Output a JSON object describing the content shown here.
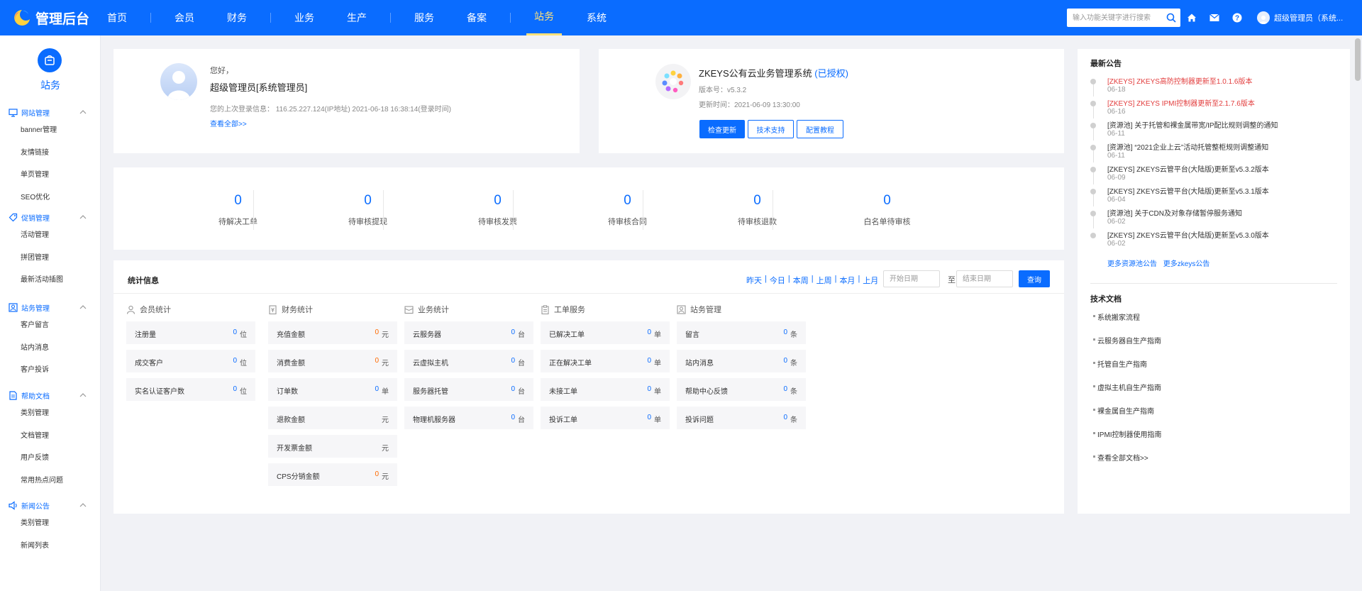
{
  "header": {
    "logo_text": "管理后台",
    "nav": [
      "首页",
      "会员",
      "财务",
      "业务",
      "生产",
      "服务",
      "备案",
      "站务",
      "系统"
    ],
    "active_nav": "站务",
    "search_placeholder": "输入功能关键字进行搜索",
    "user_name": "超级管理员（系统..."
  },
  "sidebar": {
    "title": "站务",
    "groups": [
      {
        "title": "网站管理",
        "icon": "monitor-icon",
        "items": [
          "banner管理",
          "友情链接",
          "单页管理",
          "SEO优化"
        ]
      },
      {
        "title": "促销管理",
        "icon": "tag-icon",
        "items": [
          "活动管理",
          "拼团管理",
          "最新活动插图"
        ]
      },
      {
        "title": "站务管理",
        "icon": "users-icon",
        "items": [
          "客户留言",
          "站内消息",
          "客户投诉"
        ]
      },
      {
        "title": "帮助文档",
        "icon": "document-icon",
        "items": [
          "类别管理",
          "文档管理",
          "用户反馈",
          "常用热点问题"
        ]
      },
      {
        "title": "新闻公告",
        "icon": "speaker-icon",
        "items": [
          "类别管理",
          "新闻列表"
        ]
      }
    ]
  },
  "welcome": {
    "greeting": "您好，",
    "admin_name": "超级管理员[系统管理员]",
    "last_login": "您的上次登录信息：  116.25.227.124(IP地址) 2021-06-18 16:38:14(登录时间)",
    "view_all": "查看全部>>"
  },
  "system": {
    "name": "ZKEYS公有云业务管理系统",
    "auth": "(已授权)",
    "version": "版本号：v5.3.2",
    "updated": "更新时间：2021-06-09 13:30:00",
    "btn_check": "检查更新",
    "btn_support": "技术支持",
    "btn_tutorial": "配置教程"
  },
  "stats": [
    {
      "value": "0",
      "label": "待解决工单"
    },
    {
      "value": "0",
      "label": "待审核提现"
    },
    {
      "value": "0",
      "label": "待审核发票"
    },
    {
      "value": "0",
      "label": "待审核合同"
    },
    {
      "value": "0",
      "label": "待审核退款"
    },
    {
      "value": "0",
      "label": "白名单待审核"
    }
  ],
  "statistics": {
    "title": "统计信息",
    "quick": [
      "昨天",
      "今日",
      "本周",
      "上周",
      "本月",
      "上月"
    ],
    "start_placeholder": "开始日期",
    "to": "至",
    "end_placeholder": "结束日期",
    "query": "查询",
    "columns": [
      {
        "title": "会员统计",
        "icon": "person-icon",
        "rows": [
          {
            "label": "注册量",
            "value": "0",
            "unit": "位"
          },
          {
            "label": "成交客户",
            "value": "0",
            "unit": "位"
          },
          {
            "label": "实名认证客户数",
            "value": "0",
            "unit": "位"
          }
        ]
      },
      {
        "title": "财务统计",
        "icon": "finance-icon",
        "rows": [
          {
            "label": "充值金额",
            "value": "0",
            "unit": "元",
            "orange": true
          },
          {
            "label": "消费金额",
            "value": "0",
            "unit": "元",
            "orange": true
          },
          {
            "label": "订单数",
            "value": "0",
            "unit": "单"
          },
          {
            "label": "退款金额",
            "value": "",
            "unit": "元"
          },
          {
            "label": "开发票金额",
            "value": "",
            "unit": "元"
          },
          {
            "label": "CPS分销金额",
            "value": "0",
            "unit": "元",
            "orange": true
          }
        ]
      },
      {
        "title": "业务统计",
        "icon": "box-icon",
        "rows": [
          {
            "label": "云服务器",
            "value": "0",
            "unit": "台"
          },
          {
            "label": "云虚拟主机",
            "value": "0",
            "unit": "台"
          },
          {
            "label": "服务器托管",
            "value": "0",
            "unit": "台"
          },
          {
            "label": "物理机服务器",
            "value": "0",
            "unit": "台"
          }
        ]
      },
      {
        "title": "工单服务",
        "icon": "clipboard-icon",
        "rows": [
          {
            "label": "已解决工单",
            "value": "0",
            "unit": "单"
          },
          {
            "label": "正在解决工单",
            "value": "0",
            "unit": "单"
          },
          {
            "label": "未接工单",
            "value": "0",
            "unit": "单"
          },
          {
            "label": "投诉工单",
            "value": "0",
            "unit": "单"
          }
        ]
      },
      {
        "title": "站务管理",
        "icon": "users-icon",
        "rows": [
          {
            "label": "留言",
            "value": "0",
            "unit": "条"
          },
          {
            "label": "站内消息",
            "value": "0",
            "unit": "条"
          },
          {
            "label": "帮助中心反馈",
            "value": "0",
            "unit": "条"
          },
          {
            "label": "投诉问题",
            "value": "0",
            "unit": "条"
          }
        ]
      }
    ]
  },
  "notices": {
    "title": "最新公告",
    "items": [
      {
        "text": "[ZKEYS] ZKEYS高防控制器更新至1.0.1.6版本",
        "date": "06-18",
        "red": true
      },
      {
        "text": "[ZKEYS] ZKEYS IPMI控制器更新至2.1.7.6版本",
        "date": "06-16",
        "red": true
      },
      {
        "text": "[资源池] 关于托管和裸金属带宽/IP配比规则调整的通知",
        "date": "06-11"
      },
      {
        "text": "[资源池] “2021企业上云”活动托管整柜规则调整通知",
        "date": "06-11"
      },
      {
        "text": "[ZKEYS] ZKEYS云管平台(大陆版)更新至v5.3.2版本",
        "date": "06-09"
      },
      {
        "text": "[ZKEYS] ZKEYS云管平台(大陆版)更新至v5.3.1版本",
        "date": "06-04"
      },
      {
        "text": "[资源池] 关于CDN及对象存储暂停服务通知",
        "date": "06-02"
      },
      {
        "text": "[ZKEYS] ZKEYS云管平台(大陆版)更新至v5.3.0版本",
        "date": "06-02"
      }
    ],
    "more_pool": "更多资源池公告",
    "more_zkeys": "更多zkeys公告"
  },
  "docs": {
    "title": "技术文档",
    "items": [
      "系统搬家流程",
      "云服务器自生产指南",
      "托管自生产指南",
      "虚拟主机自生产指南",
      "裸金属自生产指南",
      "IPMI控制器使用指南",
      "查看全部文档>>"
    ]
  },
  "colors": {
    "primary": "#0a6cff",
    "orange": "#ff6a00",
    "red": "#e23c3c",
    "active_nav": "#ffe27a"
  }
}
